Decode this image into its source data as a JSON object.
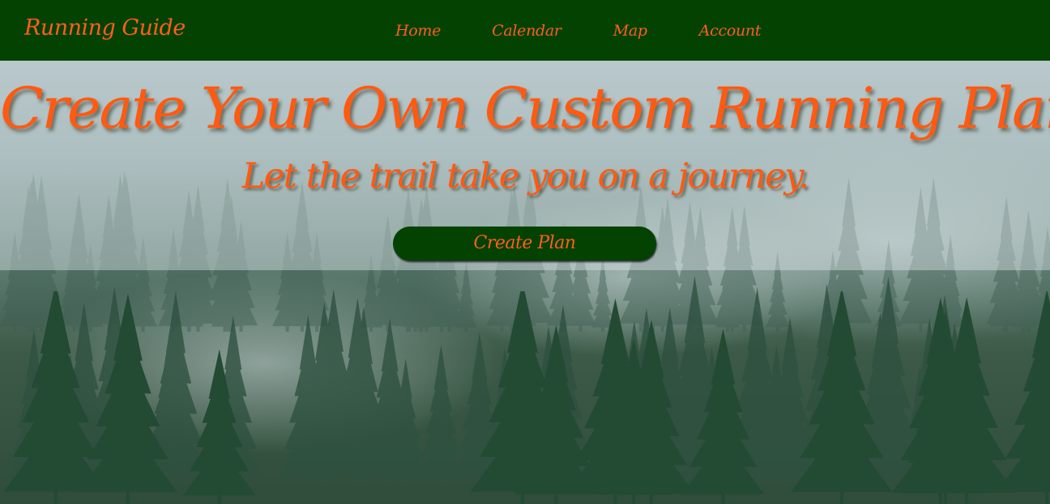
{
  "nav": {
    "brand": "Running Guide",
    "links": [
      {
        "label": "Home"
      },
      {
        "label": "Calendar"
      },
      {
        "label": "Map"
      },
      {
        "label": "Account"
      }
    ]
  },
  "hero": {
    "title": "Create Your Own Custom Running Plan",
    "subtitle": "Let the trail take you on a journey.",
    "cta_label": "Create Plan"
  },
  "colors": {
    "nav_background": "#034200",
    "accent_text": "#ff5e1a",
    "button_background": "#034200"
  },
  "background": {
    "scene": "misty-pine-forest"
  }
}
